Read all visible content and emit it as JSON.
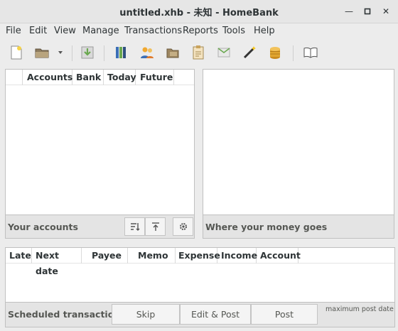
{
  "window": {
    "title": "untitled.xhb - 未知 - HomeBank"
  },
  "menubar": {
    "items": [
      "File",
      "Edit",
      "View",
      "Manage",
      "Transactions",
      "Reports",
      "Tools",
      "Help"
    ]
  },
  "toolbar": {
    "icons": [
      "new-file-icon",
      "open-folder-icon",
      "dropdown-arrow-icon",
      "save-icon",
      "accounts-icon",
      "payees-icon",
      "categories-icon",
      "scheduled-icon",
      "budget-icon",
      "assistant-wand-icon",
      "currency-coins-icon",
      "manual-book-icon"
    ]
  },
  "accounts_panel": {
    "columns": [
      "Accounts",
      "Bank",
      "Today",
      "Future"
    ],
    "footer_label": "Your accounts"
  },
  "spending_panel": {
    "footer_label": "Where your money goes"
  },
  "scheduled_panel": {
    "columns": [
      "Late",
      "Next date",
      "Payee",
      "Memo",
      "Expense",
      "Income",
      "Account"
    ],
    "footer_label": "Scheduled transactions",
    "buttons": {
      "skip": "Skip",
      "edit_post": "Edit & Post",
      "post": "Post"
    },
    "max_post_date_label": "maximum post date"
  },
  "colors": {
    "window_bg": "#ececec",
    "panel_bg": "#ffffff",
    "footer_bg": "#e4e4e4"
  }
}
